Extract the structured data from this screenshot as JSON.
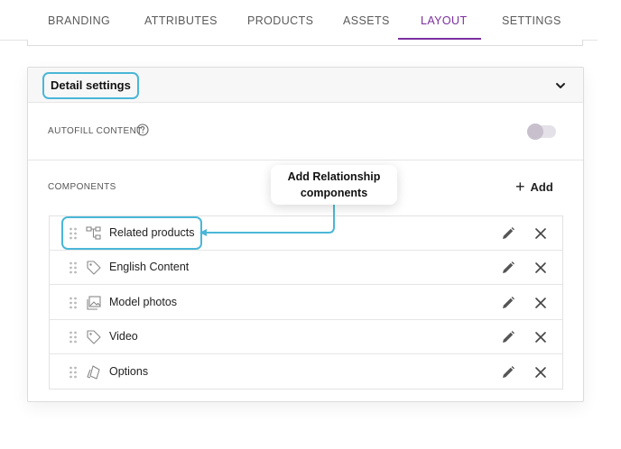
{
  "tabs": [
    {
      "label": "BRANDING",
      "active": false
    },
    {
      "label": "ATTRIBUTES",
      "active": false
    },
    {
      "label": "PRODUCTS",
      "active": false
    },
    {
      "label": "ASSETS",
      "active": false
    },
    {
      "label": "LAYOUT",
      "active": true
    },
    {
      "label": "SETTINGS",
      "active": false
    }
  ],
  "colors": {
    "accent": "#7b2f9e",
    "highlight": "#4ab7d7"
  },
  "panel": {
    "title": "Detail settings",
    "autofill_label": "AUTOFILL CONTENT",
    "autofill_enabled": false,
    "components_label": "COMPONENTS",
    "add_label": "Add"
  },
  "components": [
    {
      "label": "Related products",
      "icon": "relationship-icon"
    },
    {
      "label": "English Content",
      "icon": "tag-icon"
    },
    {
      "label": "Model photos",
      "icon": "photos-icon"
    },
    {
      "label": "Video",
      "icon": "tag-icon"
    },
    {
      "label": "Options",
      "icon": "options-icon"
    }
  ],
  "callout": {
    "line1": "Add Relationship",
    "line2": "components"
  }
}
